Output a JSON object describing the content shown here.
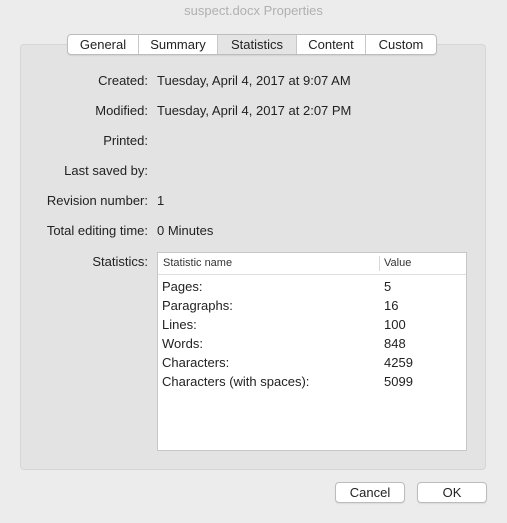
{
  "window": {
    "title": "suspect.docx Properties"
  },
  "tabs": [
    {
      "label": "General"
    },
    {
      "label": "Summary"
    },
    {
      "label": "Statistics"
    },
    {
      "label": "Content"
    },
    {
      "label": "Custom"
    }
  ],
  "active_tab": "Statistics",
  "fields": {
    "created": {
      "label": "Created:",
      "value": "Tuesday, April 4, 2017 at 9:07 AM"
    },
    "modified": {
      "label": "Modified:",
      "value": "Tuesday, April 4, 2017 at 2:07 PM"
    },
    "printed": {
      "label": "Printed:",
      "value": ""
    },
    "last_saved_by": {
      "label": "Last saved by:",
      "value": ""
    },
    "revision_number": {
      "label": "Revision number:",
      "value": "1"
    },
    "total_editing_time": {
      "label": "Total editing time:",
      "value": "0 Minutes"
    },
    "statistics": {
      "label": "Statistics:"
    }
  },
  "stats_table": {
    "headers": [
      "Statistic name",
      "Value"
    ],
    "rows": [
      {
        "name": "Pages:",
        "value": "5"
      },
      {
        "name": "Paragraphs:",
        "value": "16"
      },
      {
        "name": "Lines:",
        "value": "100"
      },
      {
        "name": "Words:",
        "value": "848"
      },
      {
        "name": "Characters:",
        "value": "4259"
      },
      {
        "name": "Characters (with spaces):",
        "value": "5099"
      }
    ]
  },
  "buttons": {
    "cancel": "Cancel",
    "ok": "OK"
  }
}
